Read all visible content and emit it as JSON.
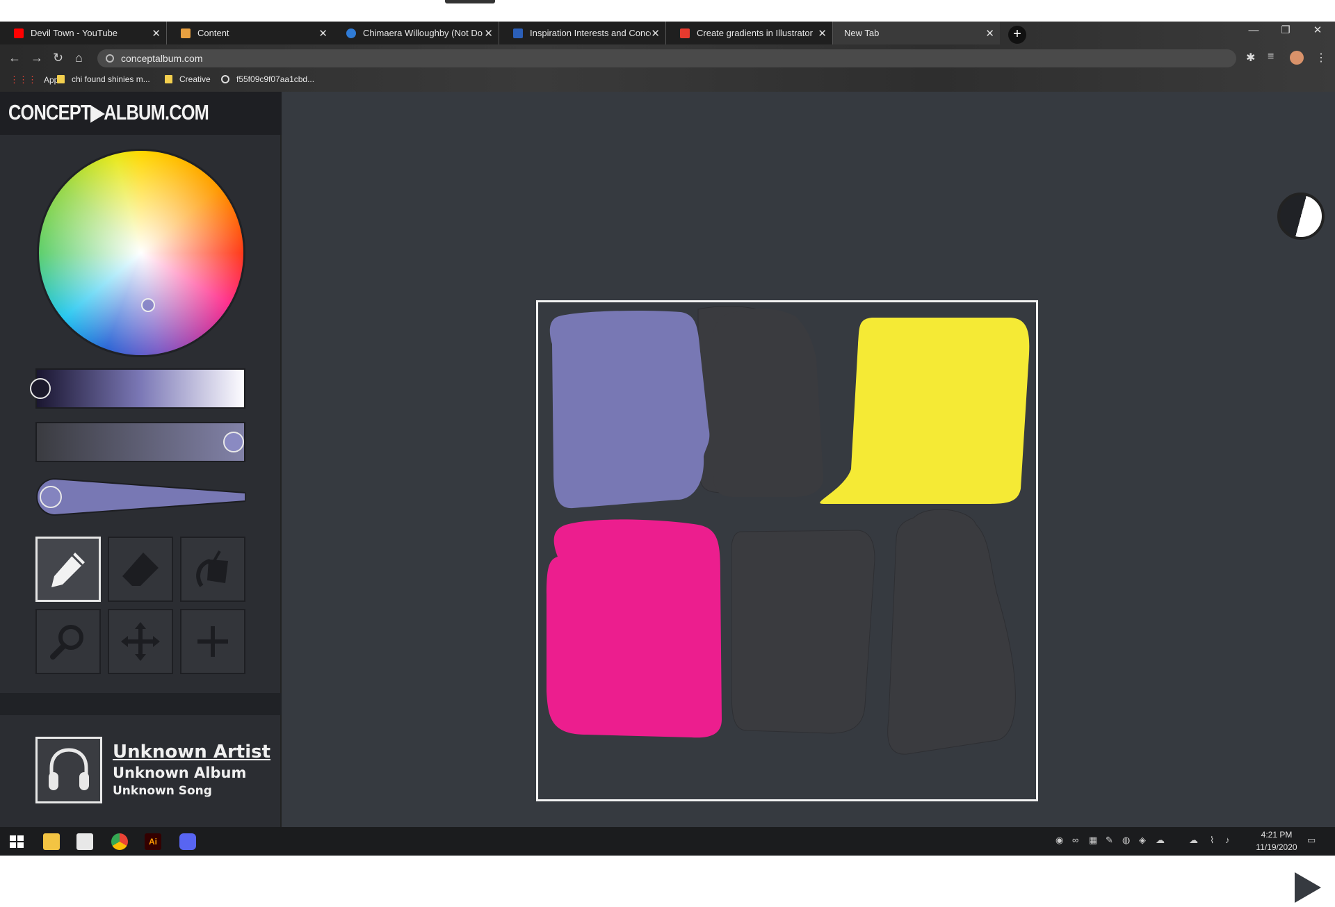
{
  "browser": {
    "tabs": [
      {
        "label": "Devil Town - YouTube",
        "favicon": "youtube-icon",
        "color": "#ff0000"
      },
      {
        "label": "Content",
        "favicon": "content-icon",
        "color": "#e8a040"
      },
      {
        "label": "Chimaera Willoughby (Not Done",
        "favicon": "onedrive-icon",
        "color": "#2f7bd6"
      },
      {
        "label": "Inspiration Interests and Concept",
        "favicon": "word-icon",
        "color": "#2b5fb8"
      },
      {
        "label": "Create gradients in Illustrator",
        "favicon": "adobe-icon",
        "color": "#e63a2e"
      },
      {
        "label": "New Tab",
        "favicon": "",
        "color": ""
      }
    ],
    "address": "conceptalbum.com",
    "bookmarks": [
      {
        "label": "Apps"
      },
      {
        "label": "chi found shinies m..."
      },
      {
        "label": "Creative"
      },
      {
        "label": "f55f09c9f07aa1cbd..."
      }
    ]
  },
  "app": {
    "logo": "CONCEPT▶ALBUM.COM",
    "color_picker": {
      "selected_color": "#7878b4"
    },
    "tools": [
      "pencil-tool",
      "eraser-tool",
      "fill-tool",
      "zoom-tool",
      "move-tool",
      "add-tool"
    ],
    "active_tool": "pencil-tool",
    "track": {
      "artist": "Unknown Artist",
      "album": "Unknown Album",
      "song": "Unknown Song"
    },
    "canvas_colors": [
      "#7878b4",
      "#3a3b3f",
      "#f5ea35",
      "#ec1e8e",
      "#3a3b3f",
      "#3a3b3f"
    ]
  },
  "taskbar": {
    "time": "4:21 PM",
    "date": "11/19/2020"
  }
}
